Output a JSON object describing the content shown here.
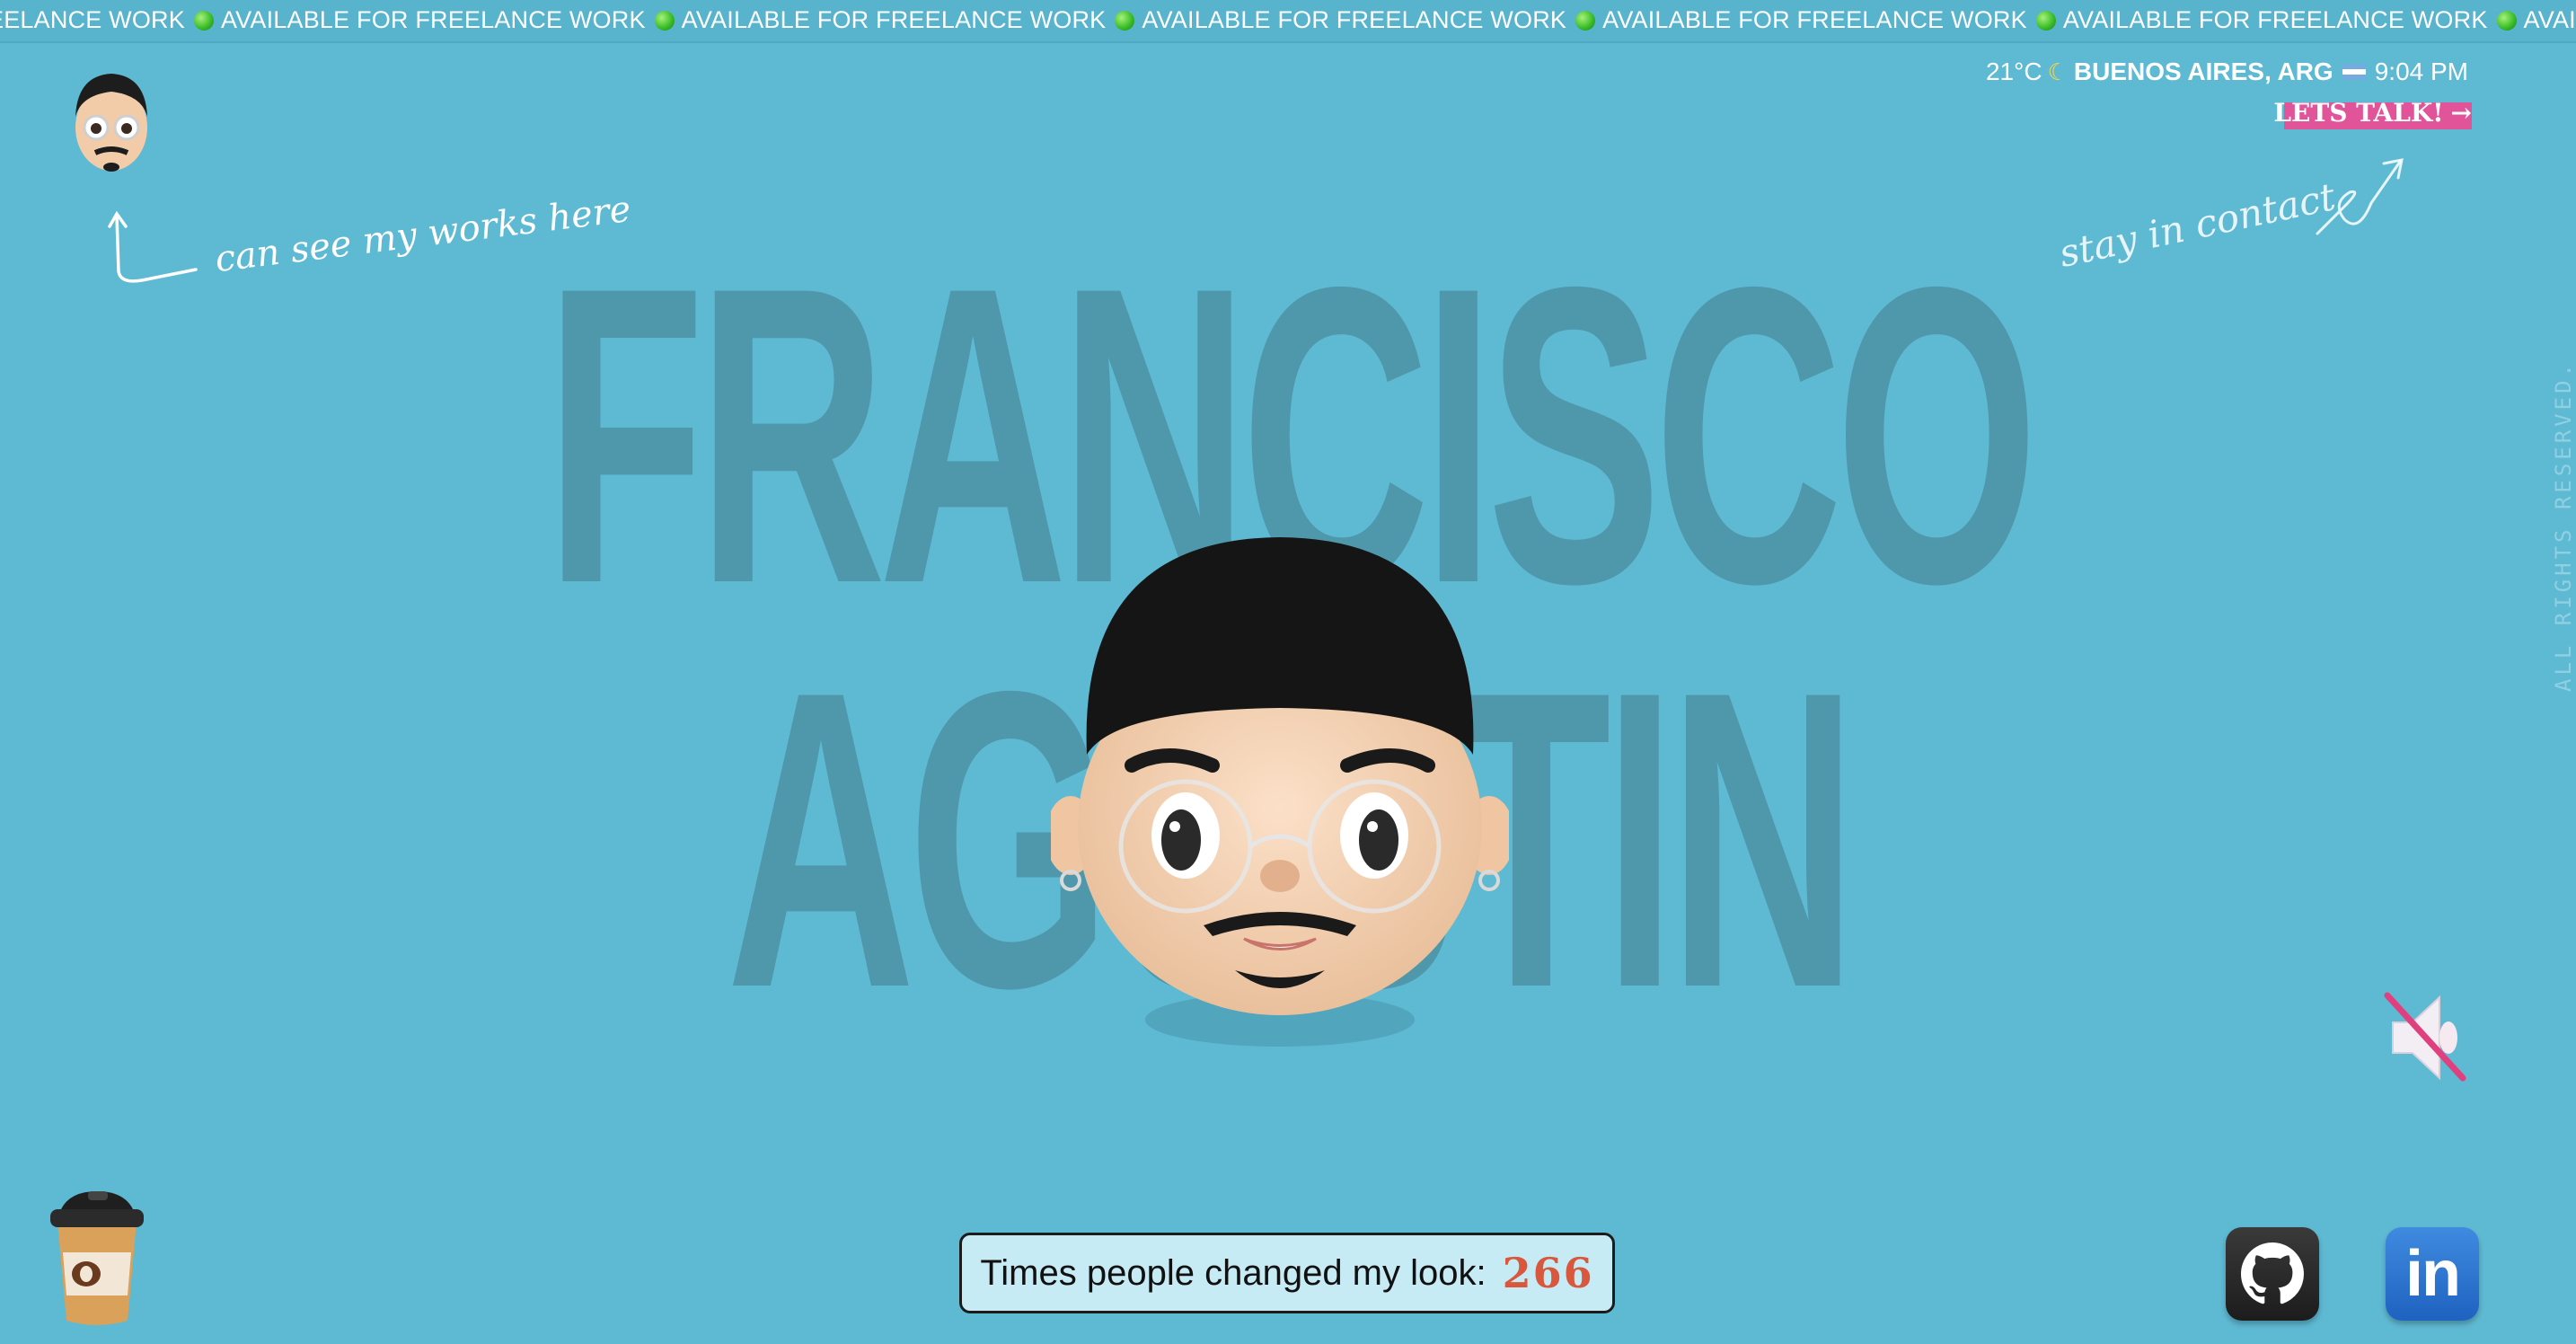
{
  "ticker": {
    "text": "AVAILABLE FOR FREELANCE WORK",
    "first_partial": "EELANCE WORK",
    "repeat": 7,
    "dot_icon": "green-dot-icon"
  },
  "hero": {
    "name_line1": "FRANCISCO",
    "name_line2": "AGUSTIN"
  },
  "annotations": {
    "works_hint": "can see my works here",
    "contact_hint": "stay in contact"
  },
  "header": {
    "temperature": "21°C",
    "city": "BUENOS AIRES, ARG",
    "time": "9:04 PM",
    "cta_label": "LETS TALK!",
    "cta_arrow": "→"
  },
  "footer": {
    "rights": "ALL RIGHTS RESERVED.",
    "counter_label": "Times people changed my look:",
    "counter_value": "266"
  },
  "colors": {
    "background": "#5eb9d3",
    "big_name": "#4f97ab",
    "cta_highlight": "#e2549a",
    "counter_value": "#d9573d"
  },
  "icons": {
    "mute": "speaker-muted-icon",
    "github": "github-icon",
    "linkedin": "linkedin-icon",
    "coffee": "coffee-cup-icon"
  }
}
